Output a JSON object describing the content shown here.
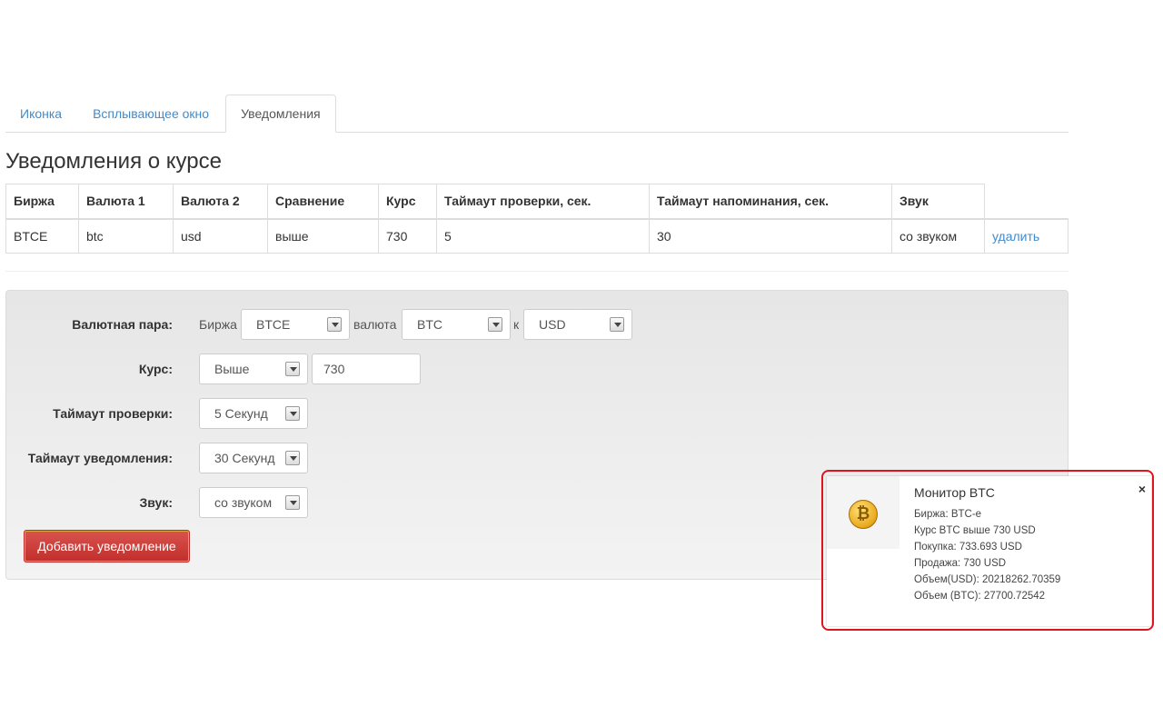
{
  "tabs": [
    {
      "label": "Иконка",
      "active": false
    },
    {
      "label": "Всплывающее окно",
      "active": false
    },
    {
      "label": "Уведомления",
      "active": true
    }
  ],
  "section_title": "Уведомления о курсе",
  "table": {
    "headers": [
      "Биржа",
      "Валюта 1",
      "Валюта 2",
      "Сравнение",
      "Курс",
      "Таймаут проверки, сек.",
      "Таймаут напоминания, сек.",
      "Звук"
    ],
    "rows": [
      {
        "cells": [
          "BTCE",
          "btc",
          "usd",
          "выше",
          "730",
          "5",
          "30",
          "со звуком"
        ],
        "action": "удалить"
      }
    ]
  },
  "form": {
    "pair_label": "Валютная пара:",
    "exchange_text": "Биржа",
    "exchange_value": "BTCE",
    "currency_text": "валюта",
    "currency1_value": "BTC",
    "to_text": "к",
    "currency2_value": "USD",
    "rate_label": "Курс:",
    "compare_value": "Выше",
    "rate_value": "730",
    "check_timeout_label": "Таймаут проверки:",
    "check_timeout_value": "5 Секунд",
    "notify_timeout_label": "Таймаут уведомления:",
    "notify_timeout_value": "30 Секунд",
    "sound_label": "Звук:",
    "sound_value": "со звуком",
    "submit_label": "Добавить уведомление"
  },
  "notification": {
    "title": "Монитор BTC",
    "close": "×",
    "icon": "bitcoin-icon",
    "lines": [
      "Биржа: BTC-e",
      "Курс BTC выше 730 USD",
      "Покупка: 733.693 USD",
      "Продажа: 730 USD",
      "Объем(USD): 20218262.70359",
      "Объем (BTC): 27700.72542"
    ],
    "highlight_color": "#e0141e"
  },
  "colors": {
    "link": "#428bca",
    "danger": "#d9534f"
  }
}
